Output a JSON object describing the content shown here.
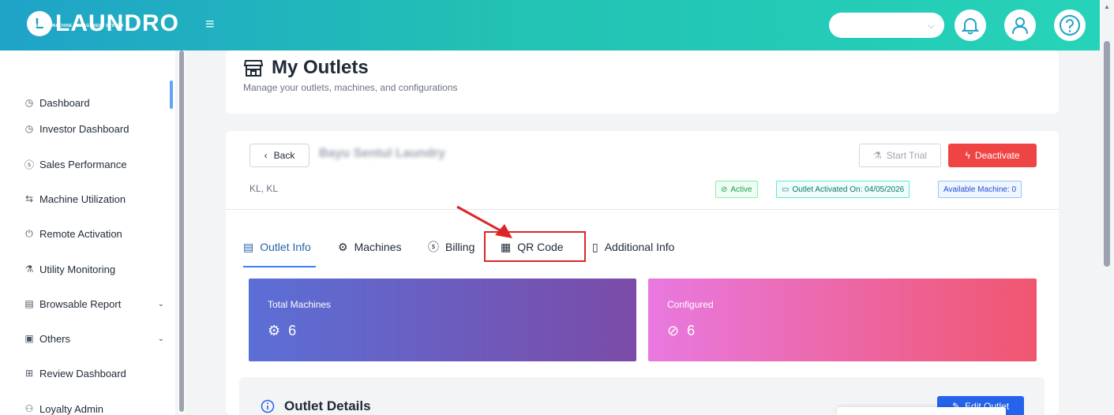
{
  "brand": {
    "badge": "L",
    "name": "LAUNDRO",
    "tagline": "LAUNDRY MACHINE MANAGEMENT SYSTEM"
  },
  "header": {
    "menu_icon": "hamburger-icon",
    "select_value": "",
    "icons": [
      "bell-icon",
      "user-icon",
      "help-icon"
    ]
  },
  "sidebar": {
    "items": [
      {
        "label": "Dashboard",
        "icon": "dashboard-icon"
      },
      {
        "label": "Investor Dashboard",
        "icon": "dashboard-icon"
      },
      {
        "label": "Sales Performance",
        "icon": "dollar-icon"
      },
      {
        "label": "Machine Utilization",
        "icon": "transfer-icon"
      },
      {
        "label": "Remote Activation",
        "icon": "power-icon"
      },
      {
        "label": "Utility Monitoring",
        "icon": "flask-icon"
      },
      {
        "label": "Browsable Report",
        "icon": "report-icon"
      },
      {
        "label": "Others",
        "icon": "folder-icon"
      },
      {
        "label": "Review Dashboard",
        "icon": "review-icon"
      },
      {
        "label": "Loyalty Admin",
        "icon": "users-icon"
      }
    ]
  },
  "page": {
    "title": "My Outlets",
    "subtitle": "Manage your outlets, machines, and configurations"
  },
  "outlet": {
    "back_label": "Back",
    "name": "Bayu Sentul Laundry",
    "location": "KL, KL",
    "start_trial_label": "Start Trial",
    "deactivate_label": "Deactivate",
    "status_label": "Active",
    "activated_label": "Outlet Activated On: 04/05/2026",
    "available_label": "Available Machine: 0"
  },
  "tabs": [
    {
      "label": "Outlet Info",
      "icon": "store-icon"
    },
    {
      "label": "Machines",
      "icon": "gear-icon"
    },
    {
      "label": "Billing",
      "icon": "dollar-icon"
    },
    {
      "label": "QR Code",
      "icon": "qr-icon"
    },
    {
      "label": "Additional Info",
      "icon": "document-icon"
    }
  ],
  "stats": [
    {
      "label": "Total Machines",
      "value": "6",
      "icon": "gear-icon"
    },
    {
      "label": "Configured",
      "value": "6",
      "icon": "check-circle-icon"
    }
  ],
  "details": {
    "title": "Outlet Details",
    "edit_label": "Edit Outlet"
  },
  "colors": {
    "header_start": "#1fa3c8",
    "header_end": "#26d3b8",
    "deactivate": "#ef4444",
    "active_tab": "#2563a8",
    "highlight": "#dc2626",
    "stat1_start": "#5b6fd6",
    "stat1_end": "#7b4ba8",
    "stat2_start": "#e879e0",
    "stat2_end": "#f0566f"
  }
}
